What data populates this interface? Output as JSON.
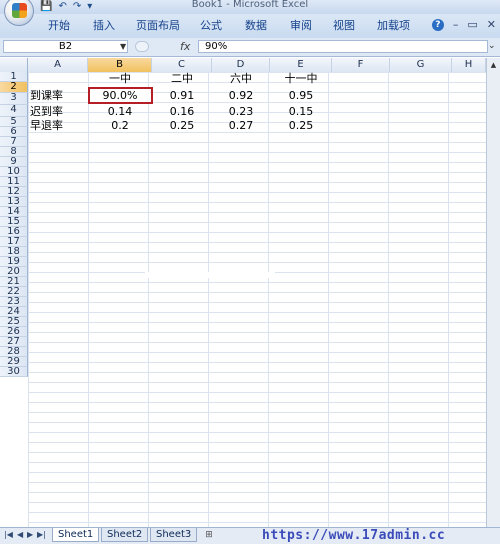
{
  "window": {
    "title": "Book1 - Microsoft Excel",
    "qat_icons": [
      "save-icon",
      "undo-icon",
      "redo-icon",
      "customize-icon"
    ]
  },
  "ribbon": {
    "tabs": [
      "开始",
      "插入",
      "页面布局",
      "公式",
      "数据",
      "审阅",
      "视图",
      "加载项"
    ],
    "controls": {
      "help": "?",
      "minimize": "–",
      "restore": "▭",
      "close": "✕"
    }
  },
  "formula_bar": {
    "name_box": "B2",
    "fx_label": "fx",
    "value": "90%"
  },
  "sheet": {
    "columns": [
      "A",
      "B",
      "C",
      "D",
      "E",
      "F",
      "G",
      "H"
    ],
    "rows": [
      "1",
      "2",
      "3",
      "4",
      "5",
      "6",
      "7",
      "8",
      "9",
      "10",
      "11",
      "12",
      "13",
      "14",
      "15",
      "16",
      "17",
      "18",
      "19",
      "20",
      "21",
      "22",
      "23",
      "24",
      "25",
      "26",
      "27",
      "28",
      "29",
      "30"
    ],
    "active_cell": "B2",
    "cells": {
      "B1": "一中",
      "C1": "二中",
      "D1": "六中",
      "E1": "十一中",
      "A2": "到课率",
      "B2": "90.0%",
      "C2": "0.91",
      "D2": "0.92",
      "E2": "0.95",
      "A3": "迟到率",
      "B3": "0.14",
      "C3": "0.16",
      "D3": "0.23",
      "E3": "0.15",
      "A4": "早退率",
      "B4": "0.2",
      "C4": "0.25",
      "D4": "0.27",
      "E4": "0.25"
    }
  },
  "sheet_tabs": {
    "tabs": [
      "Sheet1",
      "Sheet2",
      "Sheet3"
    ],
    "active": "Sheet1"
  },
  "watermark": "https://www.17admin.cc",
  "colors": {
    "selection_border": "#b61e25",
    "ribbon_text": "#15428b",
    "watermark": "#3b4bb9"
  }
}
